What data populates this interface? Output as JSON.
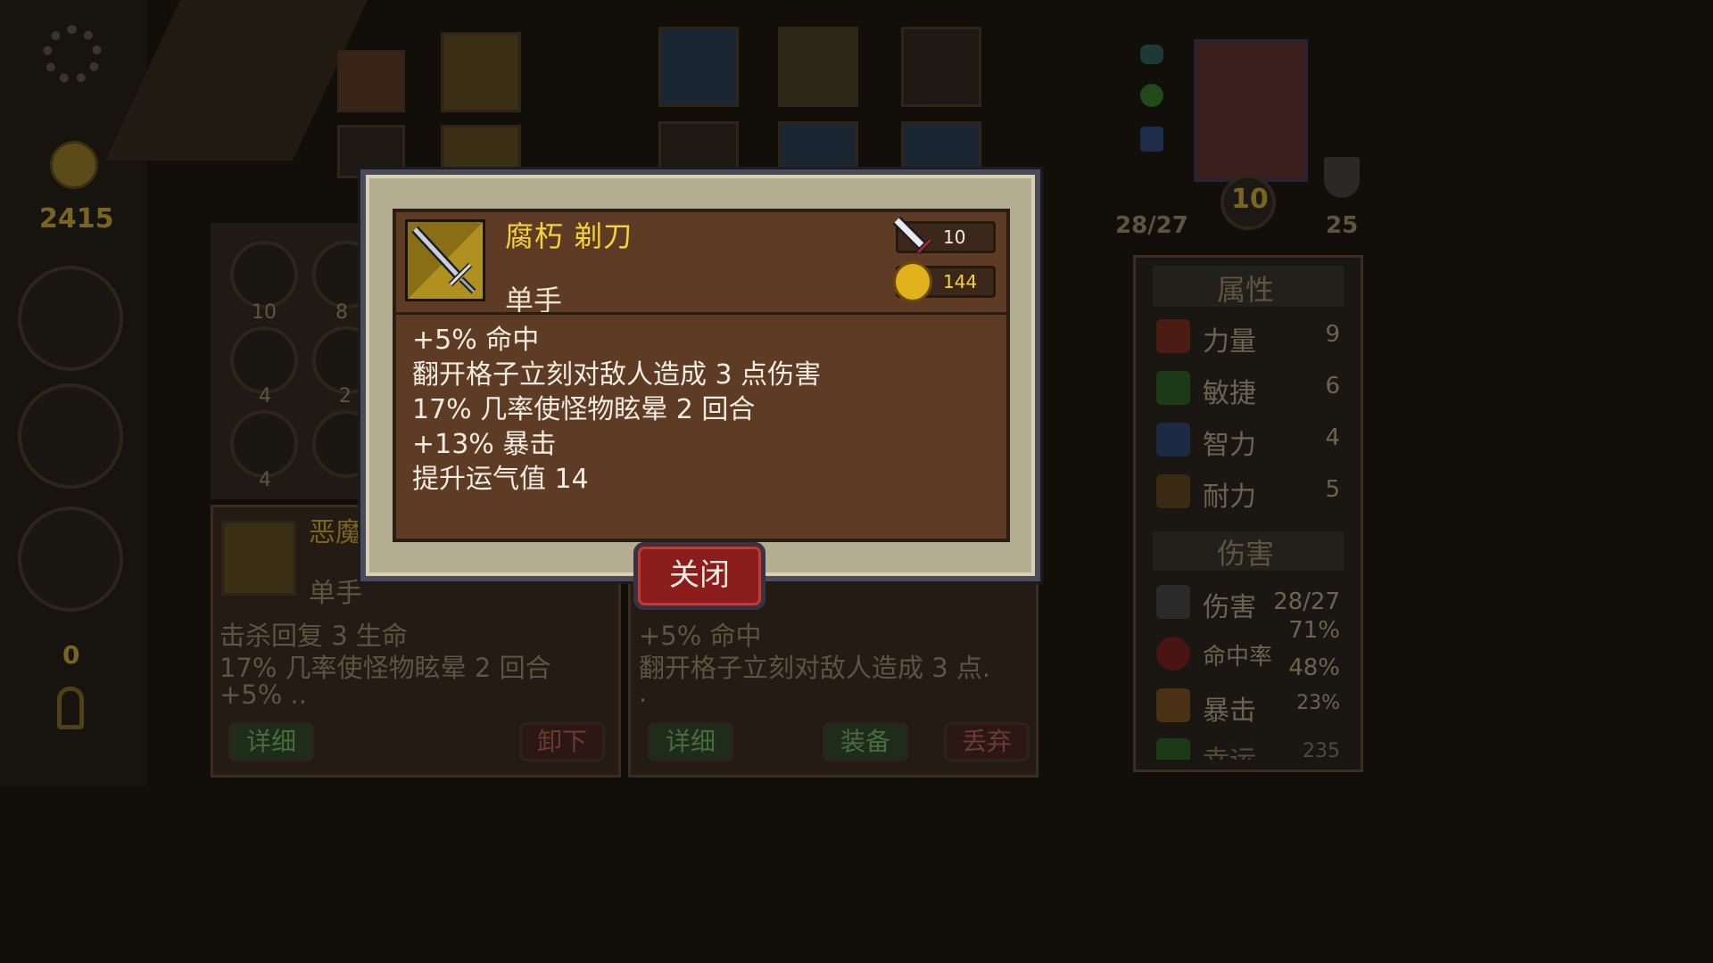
{
  "sidebar": {
    "gold": "2415",
    "keys": "0",
    "rune_counts": [
      "10",
      "8",
      "4",
      "2",
      "4"
    ]
  },
  "hero": {
    "hp": "28/27",
    "level": "10",
    "armor": "25"
  },
  "attributes": {
    "title": "属性",
    "items": [
      {
        "label": "力量",
        "value": "9"
      },
      {
        "label": "敏捷",
        "value": "6"
      },
      {
        "label": "智力",
        "value": "4"
      },
      {
        "label": "耐力",
        "value": "5"
      }
    ]
  },
  "damage": {
    "title": "伤害",
    "items": [
      {
        "label": "伤害",
        "value": "28/27"
      },
      {
        "label": "命中率",
        "value": "71%"
      },
      {
        "label": "",
        "value": "48%"
      },
      {
        "label": "暴击",
        "value": "23%"
      },
      {
        "label": "幸运",
        "value": "235"
      }
    ]
  },
  "left_card": {
    "name": "恶魔",
    "type": "单手",
    "lines": [
      "击杀回复 3 生命",
      "17% 几率使怪物眩晕 2 回合",
      "+5% .."
    ],
    "detail_btn": "详细",
    "unequip_btn": "卸下"
  },
  "right_card": {
    "lines": [
      "+5% 命中",
      "翻开格子立刻对敌人造成 3 点.",
      "."
    ],
    "detail_btn": "详细",
    "equip_btn": "装备",
    "discard_btn": "丢弃"
  },
  "dialog": {
    "item_name": "腐朽 剃刀",
    "item_type": "单手",
    "attack": "10",
    "price": "144",
    "effects": [
      "+5% 命中",
      "翻开格子立刻对敌人造成 3 点伤害",
      "17% 几率使怪物眩晕 2 回合",
      "+13% 暴击",
      "提升运气值 14"
    ],
    "close_label": "关闭"
  },
  "colors": {
    "gold_text": "#f4d43a",
    "dialog_bg": "#5d3b25",
    "close_red": "#8b1e1c"
  }
}
